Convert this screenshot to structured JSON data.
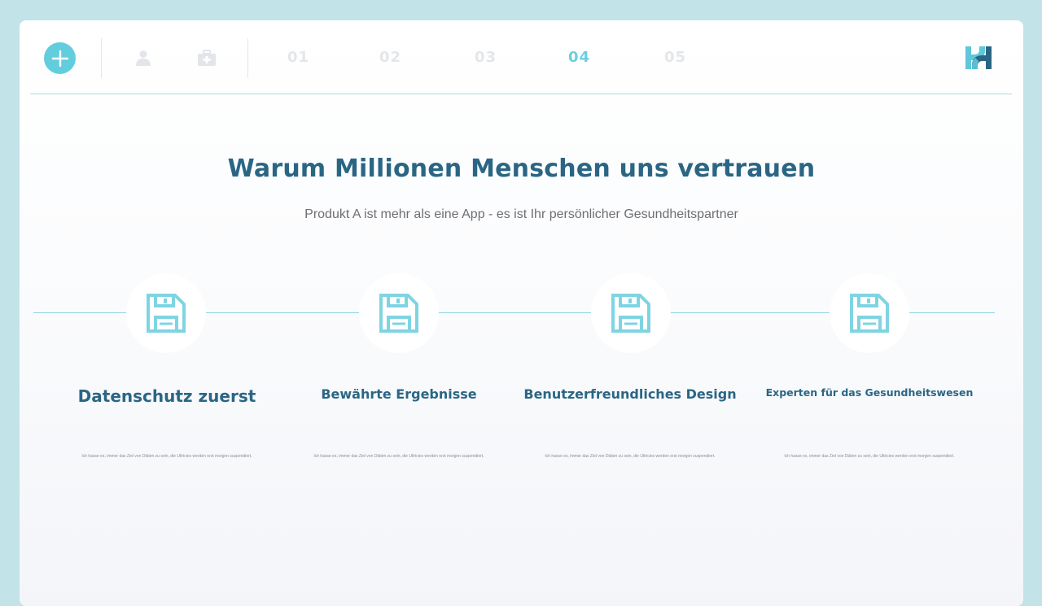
{
  "header": {
    "add_icon": "plus-icon",
    "icons": [
      "user-icon",
      "medical-kit-icon"
    ],
    "steps": [
      {
        "label": "01",
        "active": false
      },
      {
        "label": "02",
        "active": false
      },
      {
        "label": "03",
        "active": false
      },
      {
        "label": "04",
        "active": true
      },
      {
        "label": "05",
        "active": false
      }
    ],
    "logo_icon": "brand-logo-icon"
  },
  "hero": {
    "title": "Warum Millionen Menschen uns vertrauen",
    "subtitle": "Produkt A ist mehr als eine App - es ist Ihr persönlicher Gesundheitspartner"
  },
  "features": [
    {
      "icon": "floppy-disk-icon",
      "title": "Datenschutz zuerst",
      "description": "Ich hasse es, immer das Ziel von Diäten zu sein, die Ultricies werden erst morgen suspendiert."
    },
    {
      "icon": "floppy-disk-icon",
      "title": "Bewährte Ergebnisse",
      "description": "Ich hasse es, immer das Ziel von Diäten zu sein, die Ultricies werden erst morgen suspendiert."
    },
    {
      "icon": "floppy-disk-icon",
      "title": "Benutzerfreundliches Design",
      "description": "Ich hasse es, immer das Ziel von Diäten zu sein, die Ultricies werden erst morgen suspendiert."
    },
    {
      "icon": "floppy-disk-icon",
      "title": "Experten für das Gesundheitswesen",
      "description": "Ich hasse es, immer das Ziel von Diäten zu sein, die Ultricies werden erst morgen suspendiert."
    }
  ],
  "colors": {
    "accent": "#62cddd",
    "title": "#2a6684",
    "background": "#c2e3e8"
  }
}
